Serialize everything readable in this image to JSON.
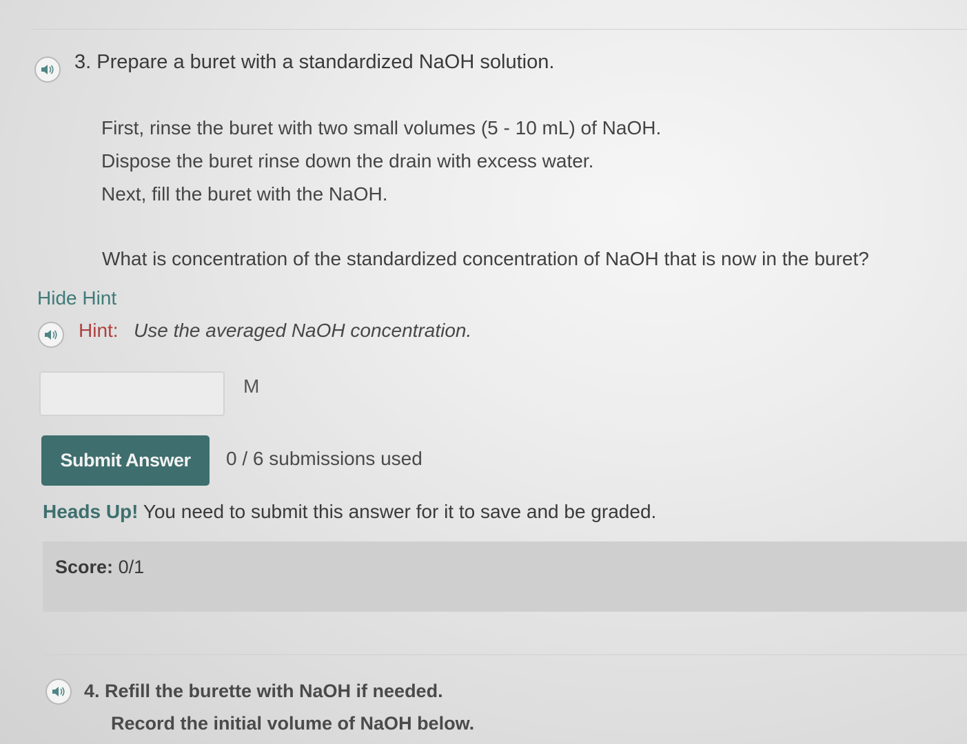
{
  "question3": {
    "title": "3. Prepare a buret with a standardized NaOH solution.",
    "instructions": [
      "First, rinse the buret with two small volumes (5 - 10 mL) of NaOH.",
      "Dispose the buret rinse down the drain with excess water.",
      "Next, fill the buret with the NaOH."
    ],
    "question": "What is concentration of the standardized concentration of NaOH that is now in the buret?",
    "hide_hint": "Hide Hint",
    "hint_label": "Hint:",
    "hint_text": "Use the averaged NaOH concentration.",
    "answer_value": "",
    "unit": "M",
    "submit_label": "Submit Answer",
    "submissions": "0 / 6 submissions used",
    "heads_up_label": "Heads Up!",
    "heads_up_text": "You need to submit this answer for it to save and be graded.",
    "score_label": "Score:",
    "score_value": "0/1"
  },
  "question4": {
    "title": "4. Refill the burette with NaOH if needed.",
    "subtitle": "Record the initial volume of NaOH below."
  },
  "icons": {
    "audio": "speaker-icon"
  },
  "colors": {
    "accent": "#3e6e6d",
    "hint_label": "#b04040",
    "hide_hint_link": "#3f7a78",
    "score_background": "#cfcfcf"
  }
}
